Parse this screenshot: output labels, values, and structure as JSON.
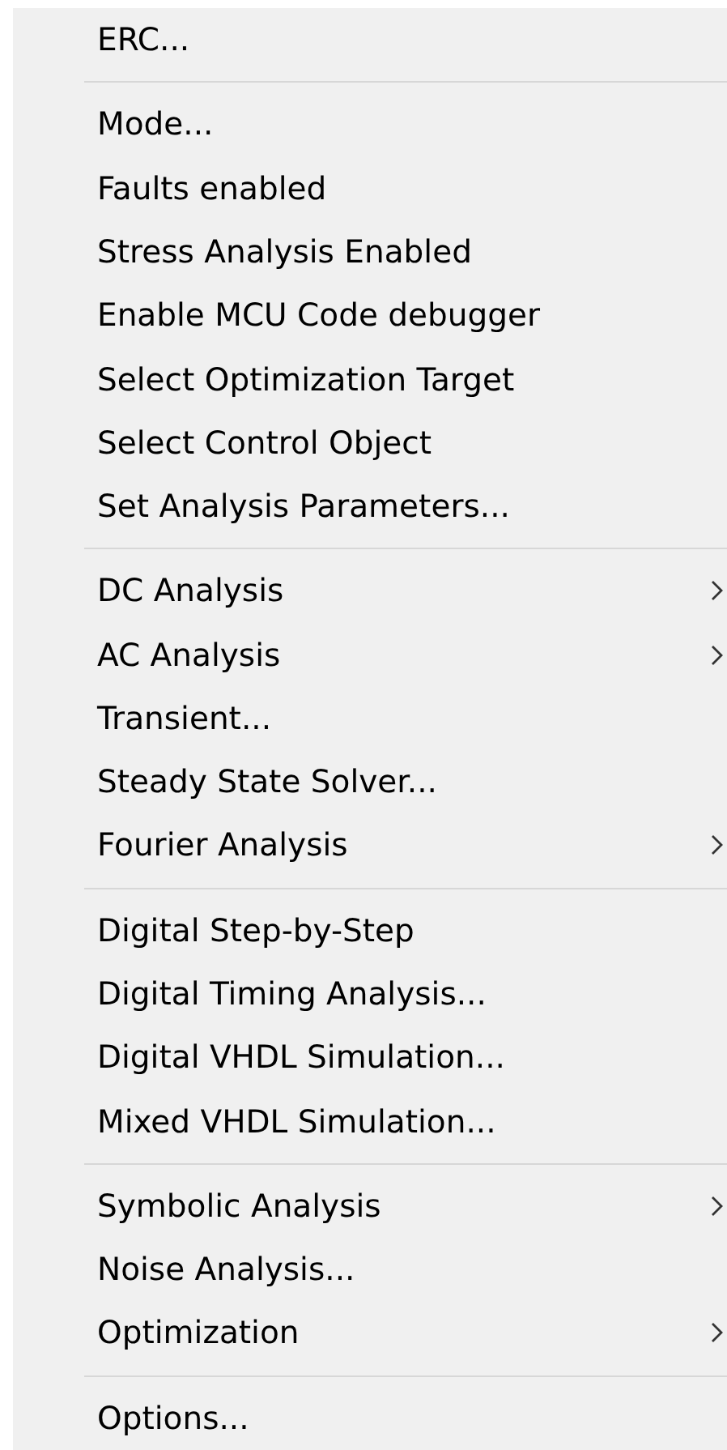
{
  "menu": {
    "sections": [
      {
        "items": [
          {
            "label": "ERC...",
            "submenu": false
          }
        ]
      },
      {
        "items": [
          {
            "label": "Mode...",
            "submenu": false
          },
          {
            "label": "Faults enabled",
            "submenu": false
          },
          {
            "label": "Stress Analysis Enabled",
            "submenu": false
          },
          {
            "label": "Enable MCU Code debugger",
            "submenu": false
          },
          {
            "label": "Select Optimization Target",
            "submenu": false
          },
          {
            "label": "Select Control Object",
            "submenu": false
          },
          {
            "label": "Set Analysis Parameters...",
            "submenu": false
          }
        ]
      },
      {
        "items": [
          {
            "label": "DC Analysis",
            "submenu": true
          },
          {
            "label": "AC Analysis",
            "submenu": true
          },
          {
            "label": "Transient...",
            "submenu": false
          },
          {
            "label": "Steady State Solver...",
            "submenu": false
          },
          {
            "label": "Fourier Analysis",
            "submenu": true
          }
        ]
      },
      {
        "items": [
          {
            "label": "Digital Step-by-Step",
            "submenu": false
          },
          {
            "label": "Digital Timing Analysis...",
            "submenu": false
          },
          {
            "label": "Digital VHDL Simulation...",
            "submenu": false
          },
          {
            "label": "Mixed VHDL Simulation...",
            "submenu": false
          }
        ]
      },
      {
        "items": [
          {
            "label": "Symbolic Analysis",
            "submenu": true
          },
          {
            "label": "Noise Analysis...",
            "submenu": false
          },
          {
            "label": "Optimization",
            "submenu": true
          }
        ]
      },
      {
        "items": [
          {
            "label": "Options...",
            "submenu": false
          }
        ]
      }
    ]
  }
}
